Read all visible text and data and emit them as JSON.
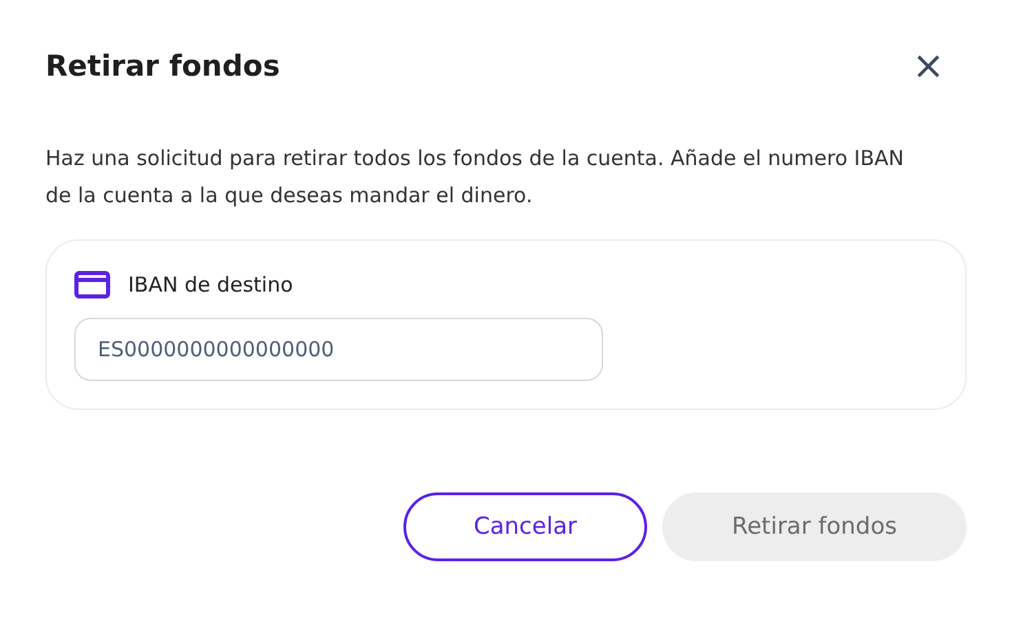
{
  "dialog": {
    "title": "Retirar fondos",
    "close": "×",
    "description": "Haz una solicitud para retirar todos los fondos de la cuenta. Añade el numero IBAN de la cuenta a la que deseas mandar el dinero.",
    "field": {
      "label": "IBAN de destino",
      "placeholder": "ES0000000000000000"
    },
    "buttons": [
      {
        "label": "Cancelar",
        "kind": "outline",
        "disabled": false
      },
      {
        "label": "Retirar fondos",
        "kind": "primary",
        "disabled": true
      }
    ]
  }
}
